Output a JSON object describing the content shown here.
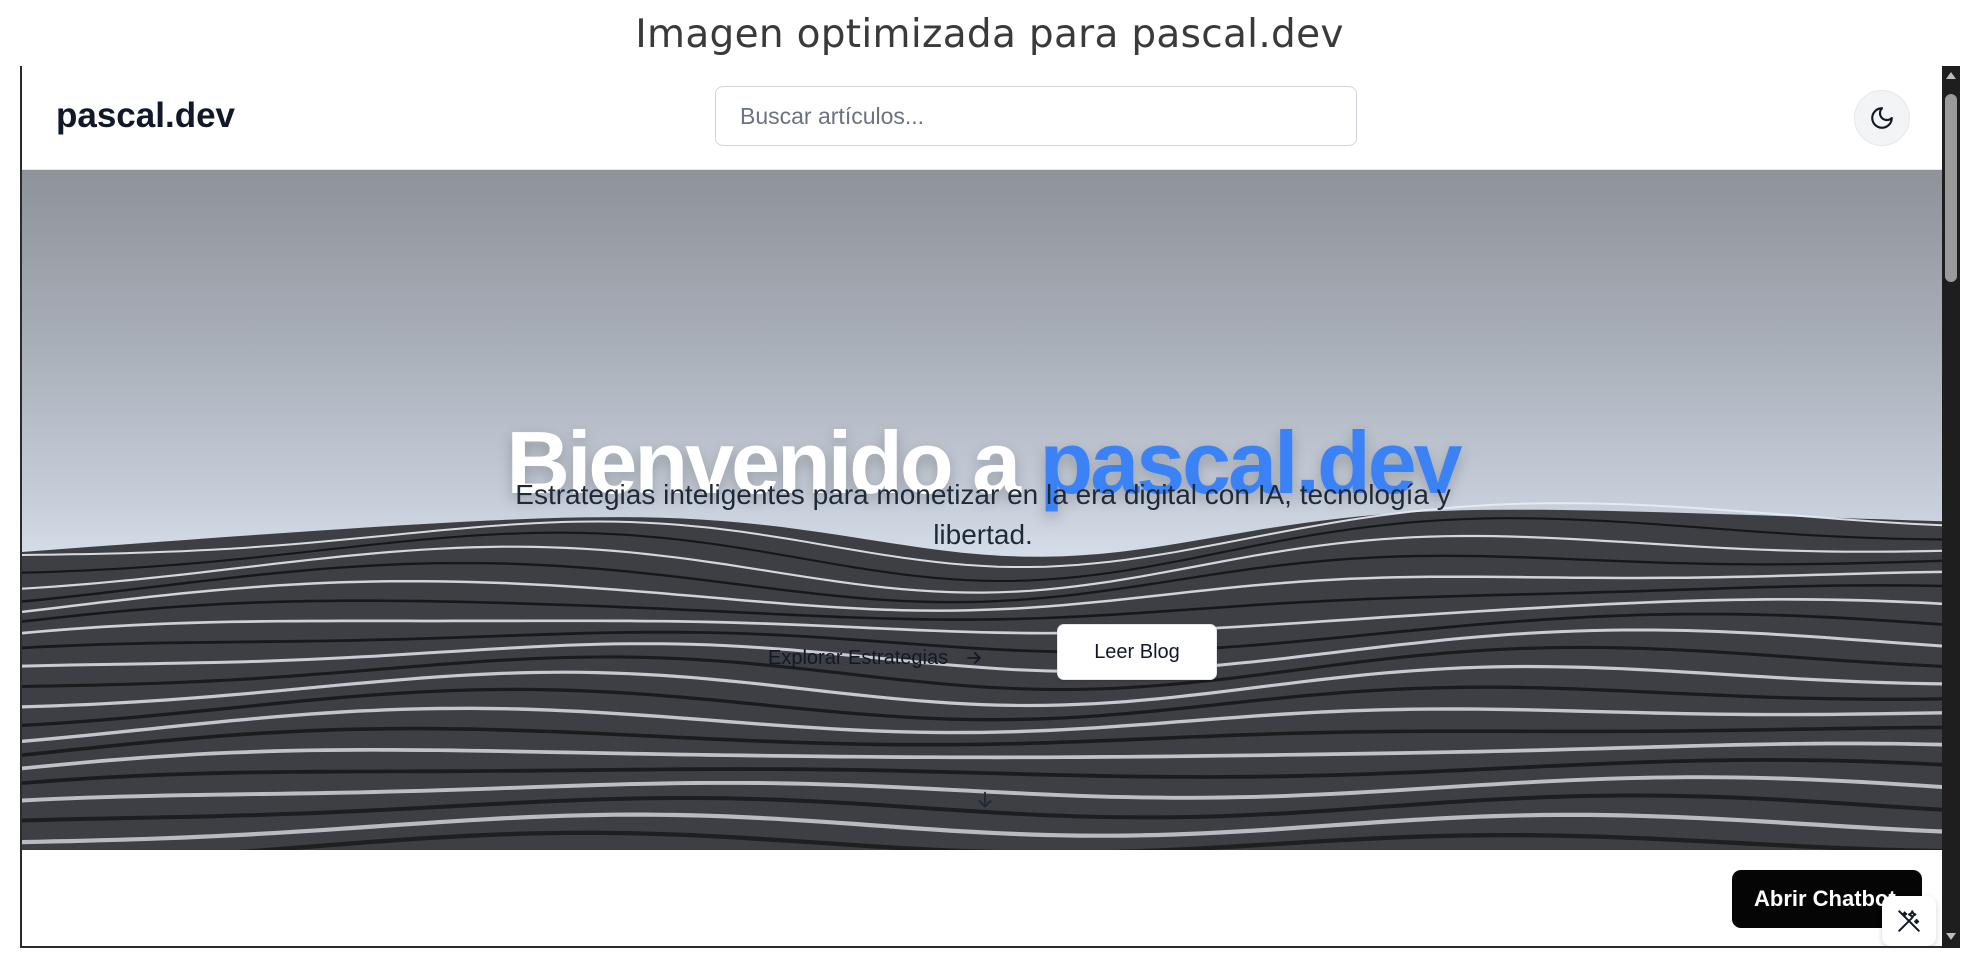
{
  "caption": "Imagen optimizada para pascal.dev",
  "navbar": {
    "logo": "pascal.dev",
    "search_placeholder": "Buscar artículos...",
    "theme_toggle_icon": "moon-icon"
  },
  "hero": {
    "title_part1": "Bienvenido a ",
    "title_part2": "pascal.dev",
    "subtitle": "Estrategias inteligentes para monetizar en la era digital con IA, tecnología y libertad.",
    "explore_label": "Explorar Estrategias",
    "explore_icon": "arrow-right-icon",
    "blog_label": "Leer Blog",
    "scroll_icon": "arrow-down-icon",
    "accent_color": "#3b82f6"
  },
  "floating": {
    "chat_label": "Abrir Chatbot",
    "wand_icon": "magic-wand-off-icon"
  }
}
